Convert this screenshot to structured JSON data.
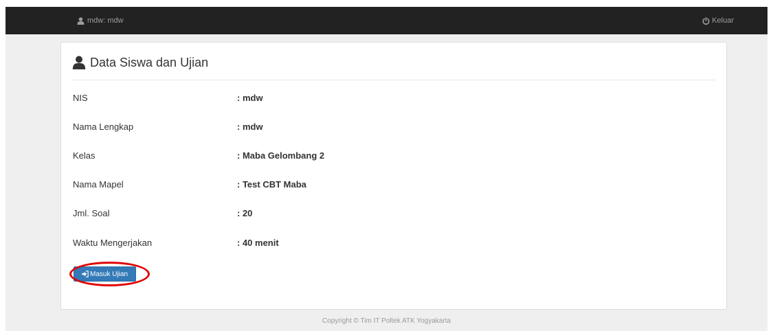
{
  "navbar": {
    "user_label": "mdw: mdw",
    "logout_label": "Keluar",
    "background_color": "#222222",
    "text_color": "#9d9d9d"
  },
  "panel": {
    "title": "Data Siswa dan Ujian",
    "title_icon": "user-icon",
    "rows": [
      {
        "label": "NIS",
        "value": ": mdw"
      },
      {
        "label": "Nama Lengkap",
        "value": ": mdw"
      },
      {
        "label": "Kelas",
        "value": ": Maba Gelombang 2"
      },
      {
        "label": "Nama Mapel",
        "value": ": Test CBT Maba"
      },
      {
        "label": "Jml. Soal",
        "value": ": 20"
      },
      {
        "label": "Waktu Mengerjakan",
        "value": ": 40 menit"
      }
    ]
  },
  "actions": {
    "start_exam_label": "Masuk Ujian",
    "start_exam_icon": "sign-in-icon",
    "button_color": "#337ab7",
    "highlight_color": "#e00000"
  },
  "footer": {
    "copyright": "Copyright © Tim IT Poltek ATK Yogyakarta"
  }
}
